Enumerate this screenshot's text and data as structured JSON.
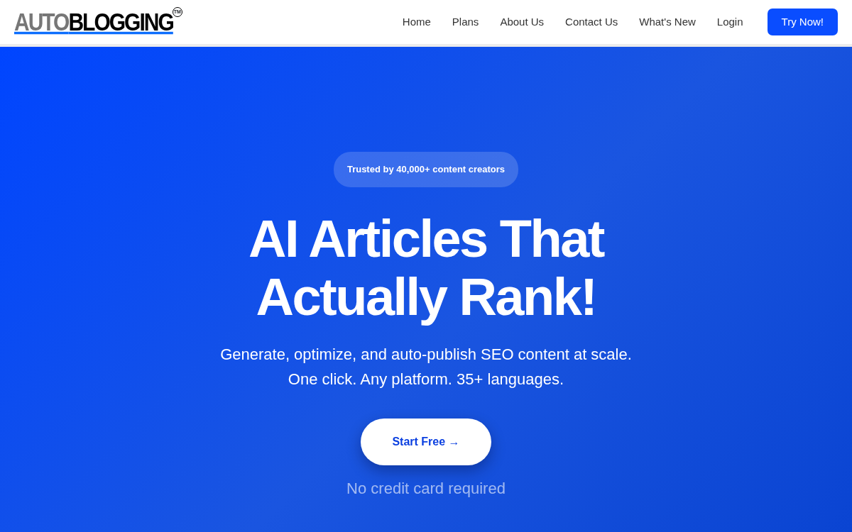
{
  "header": {
    "logo": {
      "text_grey": "AUTO",
      "text_dark": "BLOGGING",
      "trademark": "TM"
    },
    "nav": [
      {
        "label": "Home"
      },
      {
        "label": "Plans"
      },
      {
        "label": "About Us"
      },
      {
        "label": "Contact Us"
      },
      {
        "label": "What's New"
      },
      {
        "label": "Login"
      }
    ],
    "cta": "Try Now!"
  },
  "hero": {
    "badge": "Trusted by 40,000+ content creators",
    "heading_lines": [
      "AI Articles That",
      "Actually Rank!"
    ],
    "subtitle": "Generate, optimize, and auto-publish SEO content at scale.",
    "tagline": "One click. Any platform. 35+ languages.",
    "button": "Start Free →",
    "note": "No credit card required"
  }
}
